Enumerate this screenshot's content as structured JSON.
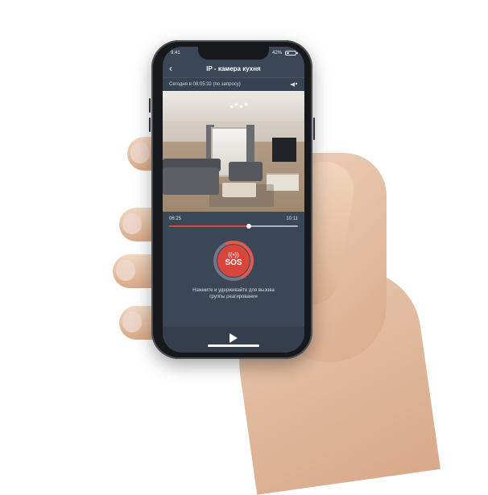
{
  "status_bar": {
    "time": "9:41",
    "battery_percent_text": "42%",
    "battery_level": 0.42,
    "icons": [
      "bluetooth-icon",
      "battery-icon"
    ]
  },
  "header": {
    "back_icon": "chevron-left-icon",
    "title": "IP - камера кухня"
  },
  "stream": {
    "timestamp_text": "Сегодня в 08:05:32 (по запросу)",
    "mute_icon": "speaker-muted-icon"
  },
  "playback": {
    "start_time": "06:25",
    "end_time": "10:11",
    "progress_fraction": 0.617
  },
  "sos": {
    "icon": "signal-broadcast-icon",
    "label": "SOS",
    "help_line_1": "Нажмите и удерживайте для вызова",
    "help_line_2": "группы реагирования"
  },
  "bottom_bar": {
    "play_icon": "play-icon"
  },
  "colors": {
    "screen_bg": "#3b4656",
    "accent": "#d9443b",
    "text": "#dbe2eb"
  }
}
